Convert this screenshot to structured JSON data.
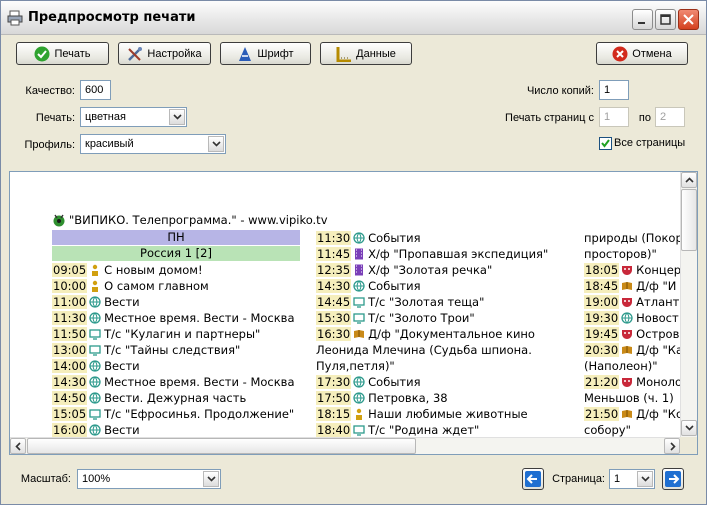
{
  "window": {
    "title": "Предпросмотр печати",
    "icon": "printer-icon"
  },
  "toolbar": {
    "print_label": "Печать",
    "setup_label": "Настройка",
    "font_label": "Шрифт",
    "data_label": "Данные",
    "cancel_label": "Отмена"
  },
  "settings": {
    "quality_label": "Качество:",
    "quality_value": "600",
    "print_label": "Печать:",
    "print_value": "цветная",
    "profile_label": "Профиль:",
    "profile_value": "красивый",
    "copies_label": "Число копий:",
    "copies_value": "1",
    "pages_label": "Печать страниц с",
    "pages_from": "1",
    "pages_to_label": "по",
    "pages_to": "2",
    "all_pages_label": "Все страницы",
    "all_pages_checked": true
  },
  "document": {
    "title": "\"ВИПИКО. Телепрограмма.\" - www.vipiko.tv",
    "day": "ПН",
    "channel": "Россия 1 [2]",
    "col1": [
      {
        "time": "09:05",
        "icon": "person",
        "text": "С новым домом!"
      },
      {
        "time": "10:00",
        "icon": "person",
        "text": "О самом главном"
      },
      {
        "time": "11:00",
        "icon": "globe",
        "text": "Вести"
      },
      {
        "time": "11:30",
        "icon": "globe",
        "text": "Местное время. Вести - Москва"
      },
      {
        "time": "11:50",
        "icon": "tv",
        "text": "Т/с \"Кулагин и партнеры\""
      },
      {
        "time": "13:00",
        "icon": "tv",
        "text": "Т/с \"Тайны следствия\""
      },
      {
        "time": "14:00",
        "icon": "globe",
        "text": "Вести"
      },
      {
        "time": "14:30",
        "icon": "globe",
        "text": "Местное время. Вести - Москва"
      },
      {
        "time": "14:50",
        "icon": "globe",
        "text": "Вести. Дежурная часть"
      },
      {
        "time": "15:05",
        "icon": "tv",
        "text": "Т/с \"Ефросинья. Продолжение\""
      },
      {
        "time": "16:00",
        "icon": "globe",
        "text": "Вести"
      }
    ],
    "col2": [
      {
        "time": "11:30",
        "icon": "globe",
        "text": "События"
      },
      {
        "time": "11:45",
        "icon": "film",
        "text": "Х/ф \"Пропавшая экспедиция\""
      },
      {
        "time": "12:35",
        "icon": "film",
        "text": "Х/ф \"Золотая речка\""
      },
      {
        "time": "14:30",
        "icon": "globe",
        "text": "События"
      },
      {
        "time": "14:45",
        "icon": "tv",
        "text": "Т/с \"Золотая теща\""
      },
      {
        "time": "15:30",
        "icon": "tv",
        "text": "Т/с \"Золото Трои\""
      },
      {
        "time": "16:30",
        "icon": "doc",
        "text": "Д/ф \"Документальное кино"
      },
      {
        "time": "",
        "icon": "",
        "text": "Леонида Млечина (Судьба шпиона."
      },
      {
        "time": "",
        "icon": "",
        "text": "Пуля,петля)\""
      },
      {
        "time": "17:30",
        "icon": "globe",
        "text": "События"
      },
      {
        "time": "17:50",
        "icon": "globe",
        "text": "Петровка, 38"
      },
      {
        "time": "18:15",
        "icon": "person",
        "text": "Наши любимые животные"
      },
      {
        "time": "18:40",
        "icon": "tv",
        "text": "Т/с \"Родина ждет\""
      }
    ],
    "col3": [
      {
        "time": "",
        "icon": "",
        "text": "природы (Покор"
      },
      {
        "time": "",
        "icon": "",
        "text": "просторов)\""
      },
      {
        "time": "18:05",
        "icon": "mask",
        "text": "Концер"
      },
      {
        "time": "18:45",
        "icon": "doc",
        "text": "Д/ф \"И"
      },
      {
        "time": "19:00",
        "icon": "mask",
        "text": "Атланти"
      },
      {
        "time": "19:30",
        "icon": "globe",
        "text": "Новост"
      },
      {
        "time": "19:45",
        "icon": "mask",
        "text": "Остров"
      },
      {
        "time": "20:30",
        "icon": "doc",
        "text": "Д/ф \"Ка"
      },
      {
        "time": "",
        "icon": "",
        "text": "(Наполеон)\""
      },
      {
        "time": "21:20",
        "icon": "mask",
        "text": "Моноло"
      },
      {
        "time": "",
        "icon": "",
        "text": "Меньшов (ч. 1)"
      },
      {
        "time": "21:50",
        "icon": "doc",
        "text": "Д/ф \"Ко"
      },
      {
        "time": "",
        "icon": "",
        "text": "собору\""
      }
    ]
  },
  "footer": {
    "scale_label": "Масштаб:",
    "scale_value": "100%",
    "page_label": "Страница:",
    "page_value": "1"
  },
  "colors": {
    "accent": "#1f6fd1",
    "day_header": "#b7b5e6",
    "channel_header": "#b9e3b6",
    "time_bg": "#f5eebc"
  }
}
